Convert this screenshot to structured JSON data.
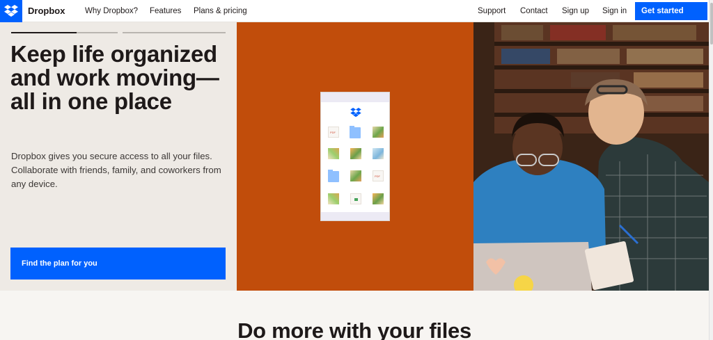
{
  "nav": {
    "brand": "Dropbox",
    "links": [
      "Why Dropbox?",
      "Features",
      "Plans & pricing"
    ],
    "right_links": [
      "Support",
      "Contact",
      "Sign up",
      "Sign in"
    ],
    "cta": "Get started"
  },
  "hero": {
    "headline": "Keep life organized and work moving—all in one place",
    "subtext": "Dropbox gives you secure access to all your files. Collaborate with friends, family, and coworkers from any device.",
    "cta": "Find the plan for you",
    "carousel_progress": 0.62
  },
  "section": {
    "title": "Do more with your files"
  },
  "colors": {
    "brand_blue": "#0061fe",
    "hero_orange": "#c14d0b",
    "hero_bg": "#eeeae5",
    "text_dark": "#1e1919"
  },
  "icons": {
    "logo": "dropbox-logo-icon",
    "file_grid": [
      "pdf-file-icon",
      "folder-icon",
      "image-file-icon",
      "image-file-icon",
      "image-file-icon",
      "image-file-icon",
      "folder-icon",
      "image-file-icon",
      "pdf-file-icon",
      "image-file-icon",
      "document-file-icon",
      "image-file-icon"
    ]
  }
}
